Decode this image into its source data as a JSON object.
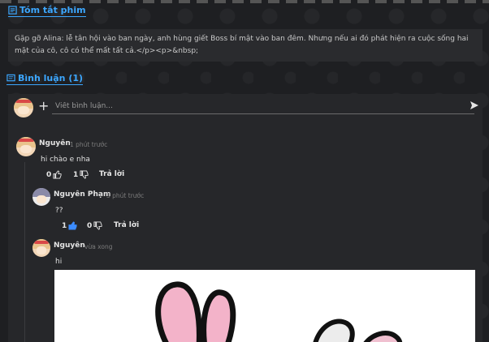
{
  "summary_section": {
    "title": "Tóm tắt phim",
    "text": "Gặp gỡ Alina: lễ tân hội vào ban ngày, anh hùng giết Boss bí mật vào ban đêm. Nhưng nếu ai đó phát hiện ra cuộc sống hai mặt của cô, cô có thể mất tất cả.</p><p>&nbsp;"
  },
  "comments_section": {
    "title": "Bình luận (1)",
    "input_placeholder": "Viết bình luận...",
    "comments": [
      {
        "name": "Nguyên",
        "time": "1 phút trước",
        "text": "hi chào e nha",
        "likes": "0",
        "dislikes": "1",
        "reply_label": "Trả lời"
      },
      {
        "name": "Nguyên Phạm",
        "time": "3 phút trước",
        "text": "??",
        "likes": "1",
        "dislikes": "0",
        "reply_label": "Trả lời"
      },
      {
        "name": "Nguyên",
        "time": "vừa xong",
        "text": "hi"
      }
    ]
  },
  "colors": {
    "accent": "#3ca7ff",
    "like_active": "#3c8cff"
  }
}
